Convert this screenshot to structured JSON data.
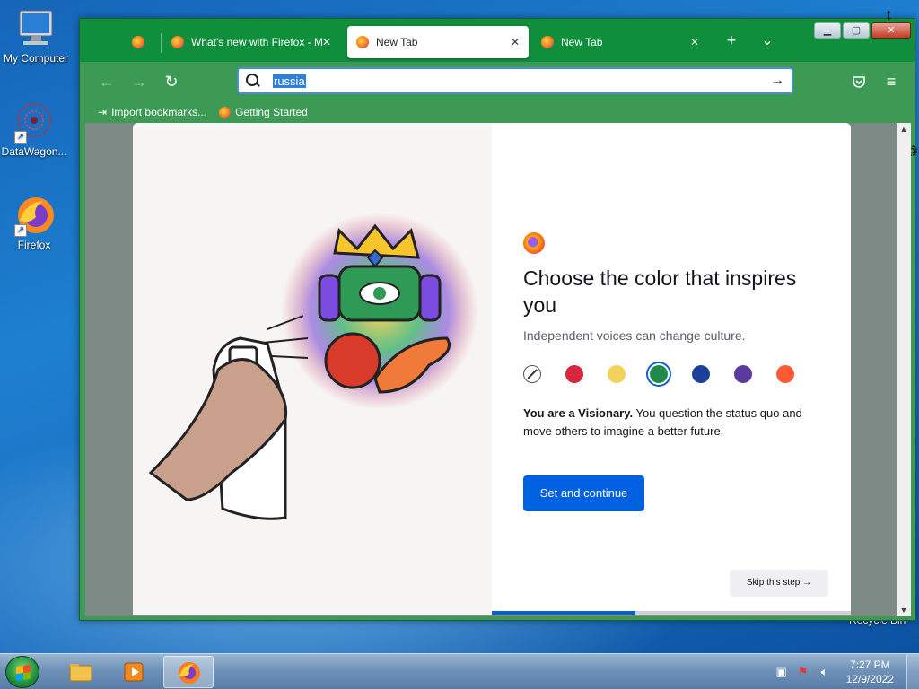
{
  "desktop": {
    "icons": [
      {
        "label": "My Computer",
        "icon": "computer-icon"
      },
      {
        "label": "DataWagon...",
        "icon": "datawagon-icon"
      },
      {
        "label": "Firefox",
        "icon": "firefox-icon"
      }
    ],
    "recycle_label": "Recycle Bin"
  },
  "browser": {
    "tabs": [
      {
        "label": "",
        "icon": "firefox-icon",
        "pinned": true
      },
      {
        "label": "What's new with Firefox - M",
        "icon": "firefox-icon"
      },
      {
        "label": "New Tab",
        "icon": "firefox-icon",
        "active": true
      },
      {
        "label": "New Tab",
        "icon": "firefox-icon"
      }
    ],
    "new_tab_symbol": "+",
    "tab_list_symbol": "⌄",
    "url_value": "russia",
    "go_symbol": "→",
    "bookmarks": [
      {
        "label": "Import bookmarks...",
        "icon": "import-icon"
      },
      {
        "label": "Getting Started",
        "icon": "firefox-icon"
      }
    ]
  },
  "onboarding": {
    "title": "Choose the color that inspires you",
    "subtitle": "Independent voices can change culture.",
    "swatches": [
      {
        "name": "none",
        "color": "#ffffff"
      },
      {
        "name": "red",
        "color": "#d7263d"
      },
      {
        "name": "yellow",
        "color": "#f2d25c"
      },
      {
        "name": "green",
        "color": "#1f8a4c",
        "selected": true
      },
      {
        "name": "blue",
        "color": "#1b3f9a"
      },
      {
        "name": "purple",
        "color": "#5a3a9e"
      },
      {
        "name": "orange",
        "color": "#ff5a36"
      }
    ],
    "description_bold": "You are a Visionary.",
    "description_rest": " You question the status quo and move others to imagine a better future.",
    "primary_button": "Set and continue",
    "skip_button": "Skip this step →",
    "progress": 0.4
  },
  "taskbar": {
    "time": "7:27 PM",
    "date": "12/9/2022",
    "accent": "#587da6"
  }
}
